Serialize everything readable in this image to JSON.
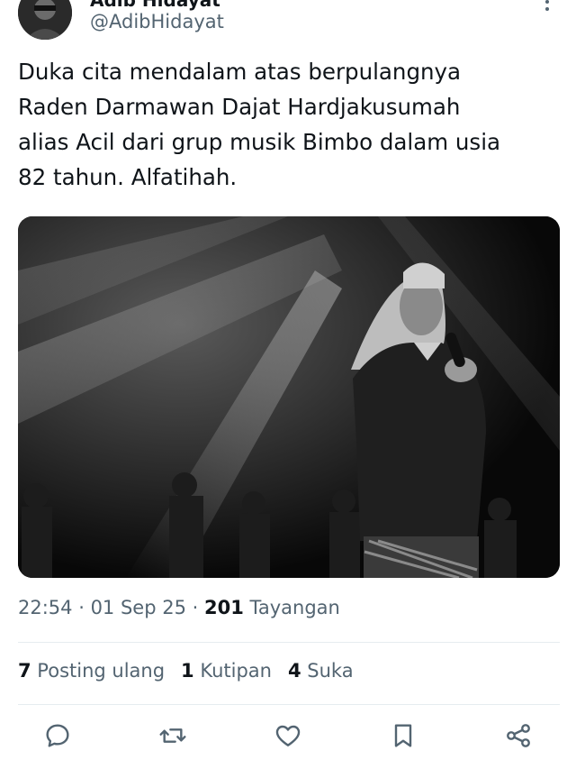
{
  "author": {
    "display_name": "Adib Hidayat",
    "handle": "@AdibHidayat"
  },
  "tweet": {
    "text_lines": [
      "Duka cita mendalam atas berpulangnya",
      "Raden Darmawan Dajat Hardjakusumah",
      "alias Acil dari grup musik Bimbo dalam usia",
      "82 tahun. Alfatihah."
    ],
    "image_description_icon": "singer-on-stage-photo"
  },
  "meta": {
    "time": "22:54",
    "sep1": " · ",
    "date": "01 Sep 25",
    "sep2": " · ",
    "views_count": "201",
    "views_label": " Tayangan"
  },
  "stats": {
    "reposts_count": "7",
    "reposts_label": " Posting ulang",
    "quotes_count": "1",
    "quotes_label": " Kutipan",
    "likes_count": "4",
    "likes_label": " Suka"
  },
  "actions": {
    "reply_icon": "reply-icon",
    "repost_icon": "repost-icon",
    "like_icon": "heart-icon",
    "bookmark_icon": "bookmark-icon",
    "share_icon": "share-icon"
  },
  "colors": {
    "text_primary": "#0f1419",
    "text_secondary": "#536471",
    "divider": "#e6ecf0"
  }
}
